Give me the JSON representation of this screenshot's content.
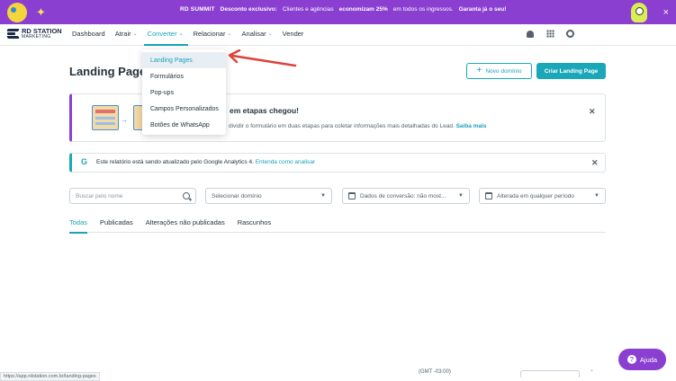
{
  "promo": {
    "brand": "RD SUMMIT",
    "lead": "Desconto exclusivo:",
    "text": "Clientes e agências",
    "highlight": "economizam 25%",
    "text2": "em todos os ingressos.",
    "cta": "Garanta já o seu!",
    "close": "×"
  },
  "brand": {
    "line1": "RD STATION",
    "line2": "MARKETING"
  },
  "nav": {
    "items": [
      {
        "label": "Dashboard",
        "chevron": false,
        "active": false
      },
      {
        "label": "Atrair",
        "chevron": true,
        "active": false
      },
      {
        "label": "Converter",
        "chevron": true,
        "active": true
      },
      {
        "label": "Relacionar",
        "chevron": true,
        "active": false
      },
      {
        "label": "Analisar",
        "chevron": true,
        "active": false
      },
      {
        "label": "Vender",
        "chevron": false,
        "active": false
      }
    ]
  },
  "dropdown": {
    "items": [
      "Landing Pages",
      "Formulários",
      "Pop-ups",
      "Campos Personalizados",
      "Botões de WhatsApp"
    ],
    "selected": "Landing Pages"
  },
  "page": {
    "title": "Landing Pages",
    "new_domain": "Novo domínio",
    "create": "Criar Landing Page"
  },
  "info": {
    "title": "em etapas chegou!",
    "desc": "dividir o formulário em duas etapas para coletar informações mais detalhadas do Lead.",
    "link": "Saiba mais"
  },
  "ga": {
    "icon": "G",
    "text": "Este relatório está sendo atualizado pelo Google Analytics 4.",
    "link": "Entenda como analisar"
  },
  "filters": {
    "search_placeholder": "Buscar pelo nome",
    "domain": "Selecionar domínio",
    "conversion": "Dados de conversão: não most...",
    "period": "Alterada em qualquer período"
  },
  "tabs": [
    "Todas",
    "Publicadas",
    "Alterações não publicadas",
    "Rascunhos"
  ],
  "footer": {
    "status_url": "https://app.rdstation.com.br/landing-pages",
    "timezone": "(GMT -03:00)",
    "help": "Ajuda"
  },
  "colors": {
    "accent": "#1aa2b8",
    "promo": "#8a3fd1",
    "arrow": "#e0403a"
  }
}
